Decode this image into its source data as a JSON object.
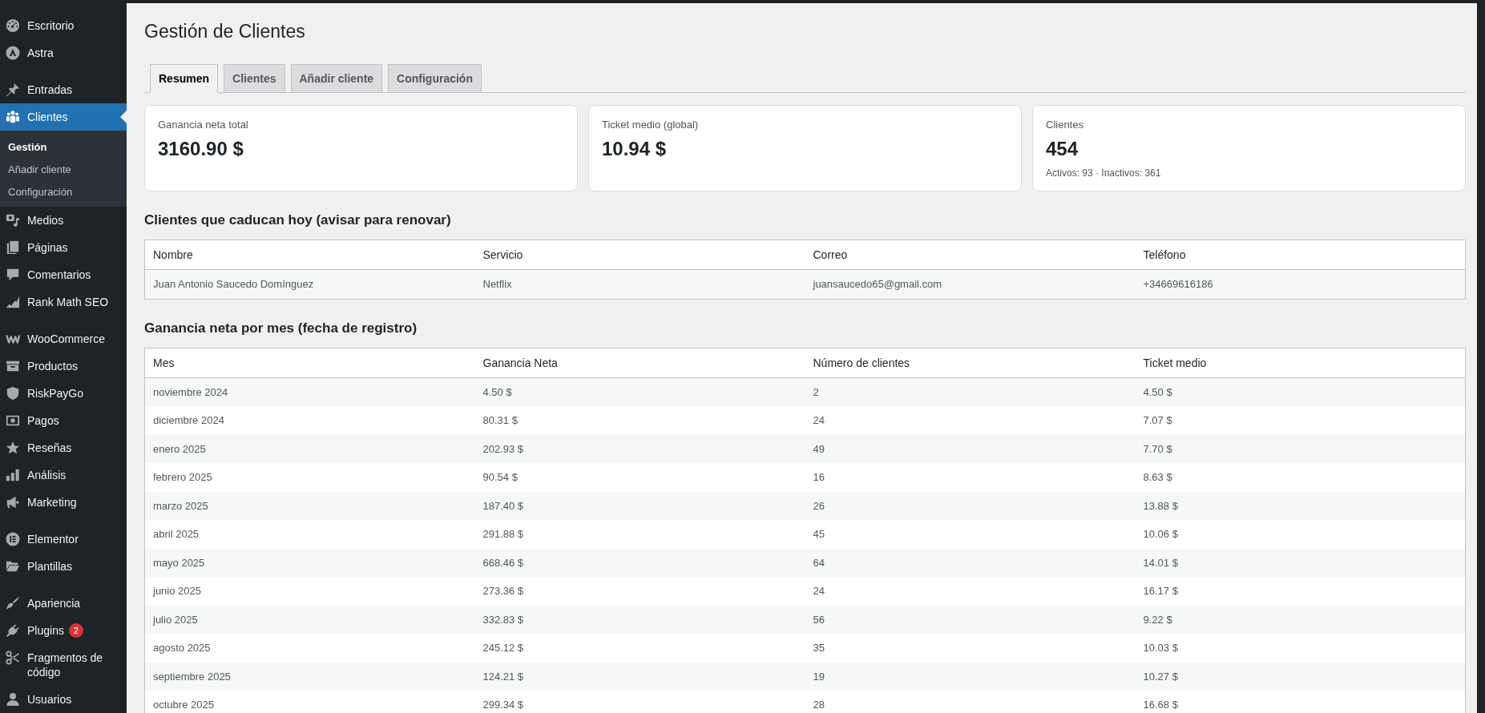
{
  "sidebar": {
    "groups": [
      {
        "items": [
          {
            "label": "Escritorio",
            "selected": false
          },
          {
            "label": "Astra",
            "selected": false
          }
        ]
      },
      {
        "items": [
          {
            "label": "Entradas",
            "selected": false
          },
          {
            "label": "Clientes",
            "selected": true,
            "children": [
              {
                "label": "Gestión",
                "selected": true
              },
              {
                "label": "Añadir cliente",
                "selected": false
              },
              {
                "label": "Configuración",
                "selected": false
              }
            ]
          },
          {
            "label": "Medios",
            "selected": false
          },
          {
            "label": "Páginas",
            "selected": false
          },
          {
            "label": "Comentarios",
            "selected": false
          },
          {
            "label": "Rank Math SEO",
            "selected": false
          }
        ]
      },
      {
        "items": [
          {
            "label": "WooCommerce",
            "selected": false
          },
          {
            "label": "Productos",
            "selected": false
          },
          {
            "label": "RiskPayGo",
            "selected": false
          },
          {
            "label": "Pagos",
            "selected": false
          },
          {
            "label": "Reseñas",
            "selected": false
          },
          {
            "label": "Análisis",
            "selected": false
          },
          {
            "label": "Marketing",
            "selected": false
          }
        ]
      },
      {
        "items": [
          {
            "label": "Elementor",
            "selected": false
          },
          {
            "label": "Plantillas",
            "selected": false
          }
        ]
      },
      {
        "items": [
          {
            "label": "Apariencia",
            "selected": false
          },
          {
            "label": "Plugins",
            "selected": false,
            "badge": "2"
          },
          {
            "label": "Fragmentos de código",
            "selected": false
          },
          {
            "label": "Usuarios",
            "selected": false
          }
        ]
      }
    ]
  },
  "page": {
    "title": "Gestión de Clientes"
  },
  "tabs": [
    {
      "label": "Resumen",
      "selected": true
    },
    {
      "label": "Clientes",
      "selected": false
    },
    {
      "label": "Añadir cliente",
      "selected": false
    },
    {
      "label": "Configuración",
      "selected": false
    }
  ],
  "stats": [
    {
      "label": "Ganancia neta total",
      "value": "3160.90 $"
    },
    {
      "label": "Ticket medio (global)",
      "value": "10.94 $"
    },
    {
      "label": "Clientes",
      "value": "454",
      "note": "Activos: 93 · Inactivos: 361"
    }
  ],
  "expiring": {
    "title": "Clientes que caducan hoy (avisar para renovar)",
    "columns": [
      "Nombre",
      "Servicio",
      "Correo",
      "Teléfono"
    ],
    "rows": [
      [
        "Juan Antonio Saucedo Domínguez",
        "Netflix",
        "juansaucedo65@gmail.com",
        "+34669616186"
      ]
    ]
  },
  "monthly": {
    "title": "Ganancia neta por mes (fecha de registro)",
    "columns": [
      "Mes",
      "Ganancia Neta",
      "Número de clientes",
      "Ticket medio"
    ],
    "rows": [
      [
        "noviembre 2024",
        "4.50 $",
        "2",
        "4.50 $"
      ],
      [
        "diciembre 2024",
        "80.31 $",
        "24",
        "7.07 $"
      ],
      [
        "enero 2025",
        "202.93 $",
        "49",
        "7.70 $"
      ],
      [
        "febrero 2025",
        "90.54 $",
        "16",
        "8.63 $"
      ],
      [
        "marzo 2025",
        "187.40 $",
        "26",
        "13.88 $"
      ],
      [
        "abril 2025",
        "291.88 $",
        "45",
        "10.06 $"
      ],
      [
        "mayo 2025",
        "668.46 $",
        "64",
        "14.01 $"
      ],
      [
        "junio 2025",
        "273.36 $",
        "24",
        "16.17 $"
      ],
      [
        "julio 2025",
        "332.83 $",
        "56",
        "9.22 $"
      ],
      [
        "agosto 2025",
        "245.12 $",
        "35",
        "10.03 $"
      ],
      [
        "septiembre 2025",
        "124.21 $",
        "19",
        "10.27 $"
      ],
      [
        "octubre 2025",
        "299.34 $",
        "28",
        "16.68 $"
      ]
    ]
  }
}
